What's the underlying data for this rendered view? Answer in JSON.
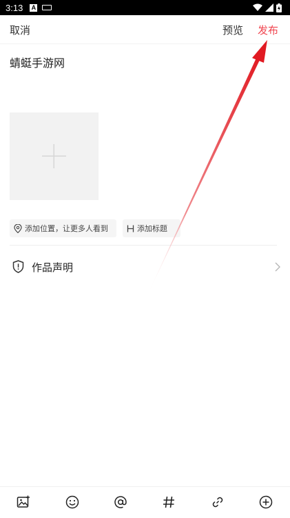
{
  "status_bar": {
    "time": "3:13",
    "notification_badge": "A"
  },
  "header": {
    "cancel_label": "取消",
    "preview_label": "预览",
    "publish_label": "发布",
    "publish_color": "#f0454f"
  },
  "post": {
    "title": "蜻蜓手游网"
  },
  "chips": {
    "location_label": "添加位置，让更多人看到",
    "heading_label": "添加标题"
  },
  "declaration": {
    "label": "作品声明"
  },
  "toolbar": {
    "icons": [
      "image-icon",
      "emoji-icon",
      "mention-icon",
      "hashtag-icon",
      "link-icon",
      "add-circle-icon"
    ]
  },
  "annotation": {
    "arrow_color": "#e11a22",
    "points_to": "publish-button"
  }
}
